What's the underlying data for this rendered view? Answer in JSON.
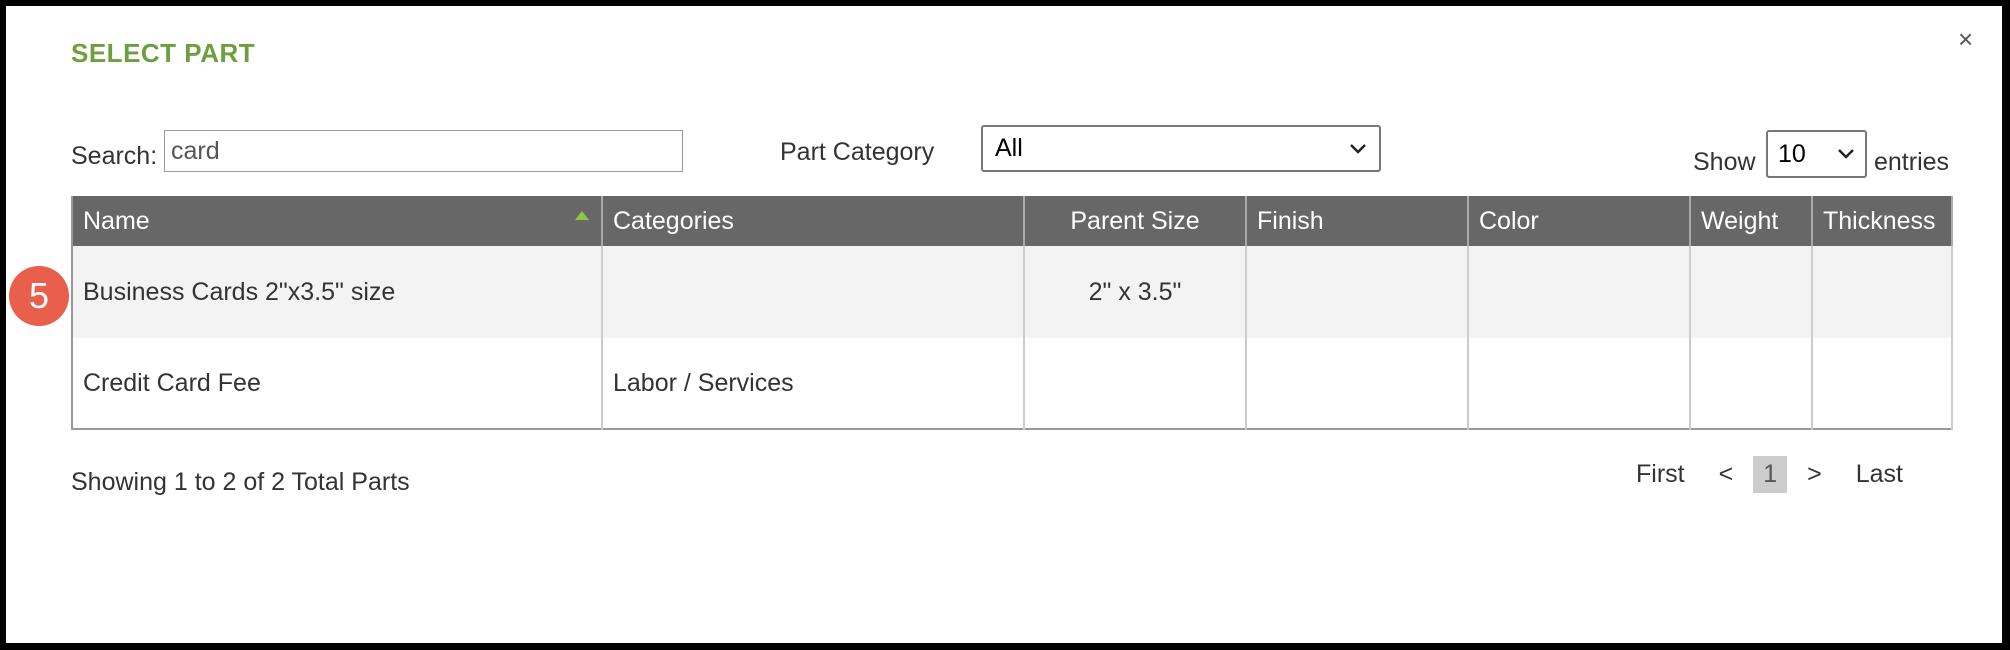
{
  "dialog": {
    "title": "SELECT PART",
    "close_glyph": "×"
  },
  "search": {
    "label": "Search:",
    "value": "card"
  },
  "category": {
    "label": "Part Category",
    "selected": "All"
  },
  "show": {
    "label": "Show",
    "selected": "10",
    "suffix": "entries"
  },
  "table": {
    "headers": [
      "Name",
      "Categories",
      "Parent Size",
      "Finish",
      "Color",
      "Weight",
      "Thickness"
    ],
    "rows": [
      [
        "Business Cards 2\"x3.5\" size",
        "",
        "2\" x 3.5\"",
        "",
        "",
        "",
        ""
      ],
      [
        "Credit Card Fee",
        "Labor / Services",
        "",
        "",
        "",
        "",
        ""
      ]
    ]
  },
  "badge": {
    "number": "5",
    "color": "#e8604c"
  },
  "footer": {
    "info": "Showing 1 to 2 of 2 Total Parts"
  },
  "pagination": {
    "first": "First",
    "prev": "<",
    "current": "1",
    "next": ">",
    "last": "Last"
  },
  "colors": {
    "title": "#6f9e3f",
    "header_bg": "#676767",
    "sort_arrow": "#8dc63f"
  }
}
